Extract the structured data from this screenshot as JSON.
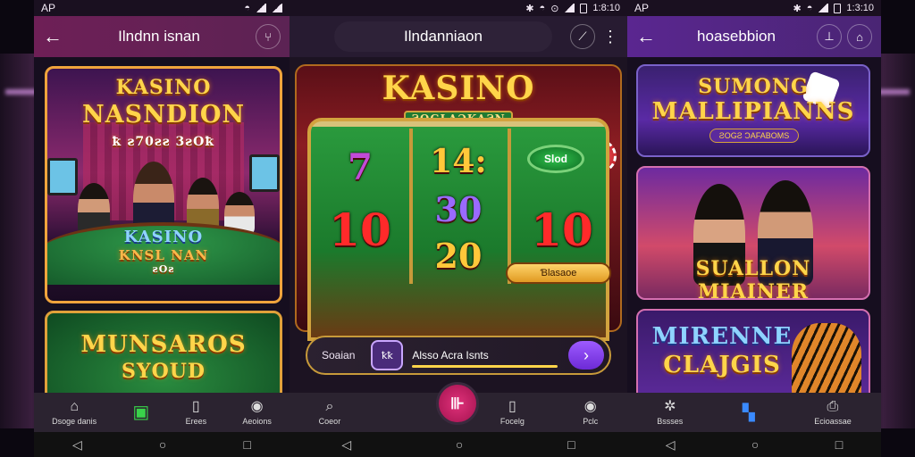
{
  "status": {
    "left_label": "AP",
    "time_center": "1:8:10",
    "time_right": "1:3:10"
  },
  "phone1": {
    "title": "Ilndnn isnan",
    "card1": {
      "title_line1": "KASINO",
      "title_line2": "NASNDION",
      "title_line3": "ꝁ ƨ70ƨƨ 3ƨOꝁ",
      "table_text1": "KASINO",
      "table_text2": "KNSL NAN",
      "table_text3": "ƨOƨ"
    },
    "card2": {
      "title_line1": "MUNSAROS",
      "title_line2": "SYOUD"
    },
    "nav": [
      {
        "label": "Dsoge danis",
        "icon": "home-icon"
      },
      {
        "label": "",
        "icon": "cart-icon"
      },
      {
        "label": "Erees",
        "icon": "phone-icon"
      },
      {
        "label": "Aeoions",
        "icon": "location-icon"
      }
    ]
  },
  "phone2": {
    "title": "Ilndanniaon",
    "slot": {
      "title": "KASINO",
      "subtitle": "ƧOGLAƆKAƧN",
      "badge": "Slod",
      "symbols": [
        "7",
        "14:",
        "30",
        "10",
        "10",
        "20"
      ],
      "pill": "Ɓlasaoe"
    },
    "search": {
      "label": "Soaian",
      "chip": "ꝁꝁ",
      "text": "Alsso Acra Isnts"
    },
    "nav": [
      {
        "label": "Coeor",
        "icon": "search-icon"
      },
      {
        "label": "",
        "icon": "add-icon"
      },
      {
        "label": "Focelg",
        "icon": "phone-icon"
      },
      {
        "label": "Pclc",
        "icon": "location-icon"
      }
    ]
  },
  "phone3": {
    "title": "hoasebbion",
    "card1": {
      "title_line1": "SUMONG",
      "title_line2": "MALLIPIANNS",
      "sub": "ƧOGƧ ƆAFABOMS"
    },
    "card2": {
      "title": "SUALLON MIAINER"
    },
    "card3": {
      "title_line1": "MIRENNE",
      "title_line2": "CLAJGIS"
    },
    "nav": [
      {
        "label": "Bssses",
        "icon": "settings-icon"
      },
      {
        "label": "",
        "icon": "grid-icon"
      },
      {
        "label": "Ecioassae",
        "icon": "print-icon"
      }
    ]
  },
  "colors": {
    "accent": "#ffd54a",
    "fab": "#d0246a",
    "p3_bar": "#5a2690"
  }
}
